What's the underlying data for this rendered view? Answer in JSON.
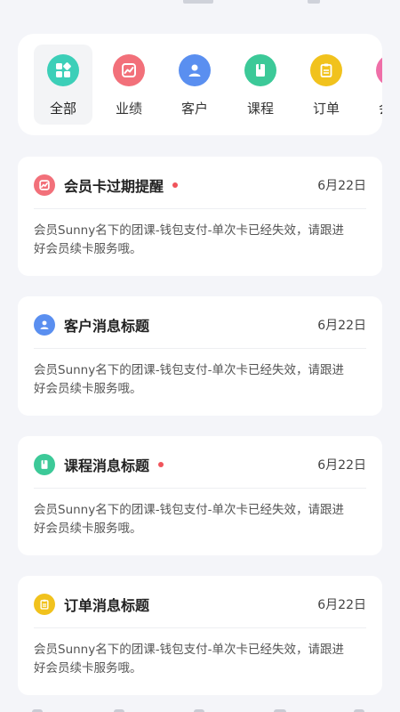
{
  "categories": [
    {
      "label": "全部",
      "color": "#3ccfb8",
      "icon": "grid-icon",
      "active": true
    },
    {
      "label": "业绩",
      "color": "#f2707a",
      "icon": "trend-chart-icon",
      "active": false
    },
    {
      "label": "客户",
      "color": "#5a8ff0",
      "icon": "user-icon",
      "active": false
    },
    {
      "label": "课程",
      "color": "#3cc998",
      "icon": "book-icon",
      "active": false
    },
    {
      "label": "订单",
      "color": "#f1c21d",
      "icon": "clipboard-icon",
      "active": false
    },
    {
      "label": "会员",
      "color": "#ef6fa8",
      "icon": "member-icon",
      "active": false
    }
  ],
  "messages": [
    {
      "title": "会员卡过期提醒",
      "date": "6月22日",
      "unread": true,
      "icon": "trend-chart-icon",
      "color": "#f2707a",
      "body": "会员Sunny名下的团课-钱包支付-单次卡已经失效，请跟进好会员续卡服务哦。"
    },
    {
      "title": "客户消息标题",
      "date": "6月22日",
      "unread": false,
      "icon": "user-icon",
      "color": "#5a8ff0",
      "body": "会员Sunny名下的团课-钱包支付-单次卡已经失效，请跟进好会员续卡服务哦。"
    },
    {
      "title": "课程消息标题",
      "date": "6月22日",
      "unread": true,
      "icon": "book-icon",
      "color": "#3cc998",
      "body": "会员Sunny名下的团课-钱包支付-单次卡已经失效，请跟进好会员续卡服务哦。"
    },
    {
      "title": "订单消息标题",
      "date": "6月22日",
      "unread": false,
      "icon": "clipboard-icon",
      "color": "#f1c21d",
      "body": "会员Sunny名下的团课-钱包支付-单次卡已经失效，请跟进好会员续卡服务哦。"
    }
  ]
}
